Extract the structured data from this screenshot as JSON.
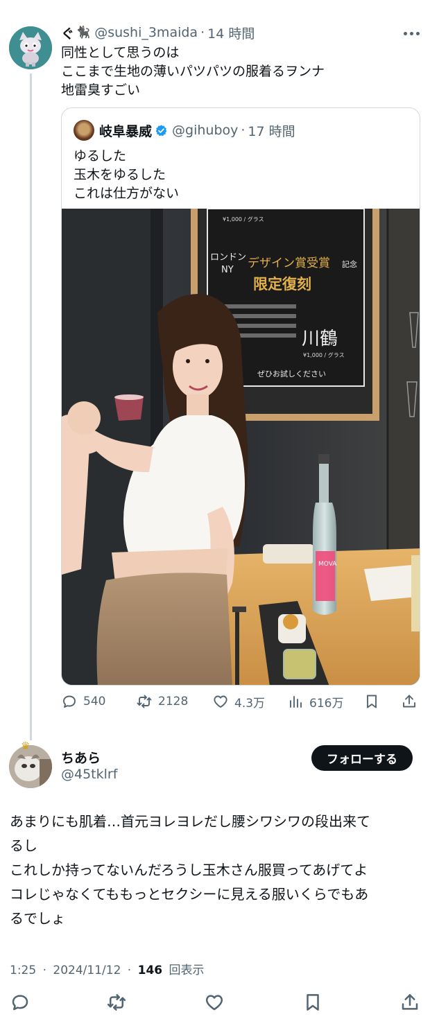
{
  "thread": {
    "parent": {
      "display_name": "ぐ",
      "name_emoji": "🐈‍⬛",
      "handle": "@sushi_3maida",
      "separator": "·",
      "time": "14 時間",
      "text": "同性として思うのは\nここまで生地の薄いパツパツの服着るヲンナ\n地雷臭すごい",
      "avatar_icon": "cartoon-cat-avatar",
      "quote": {
        "display_name": "岐阜暴威",
        "verified_icon": "verified-badge-icon",
        "handle": "@gihuboy",
        "separator": "·",
        "time": "17 時間",
        "text": "ゆるした\n玉木をゆるした\nこれは仕方がない",
        "photo": {
          "menu_price_top": "¥1,000 / グラス",
          "menu_left": "ロンドン\nNY",
          "menu_award": "デザイン賞受賞",
          "menu_award_suffix": "記念",
          "menu_limited": "限定復刻",
          "menu_brand": "川鶴",
          "menu_price_bottom": "¥1,000 / グラス",
          "menu_footer": "ぜひお試しください",
          "bottle_label": "MOVA"
        }
      },
      "actions": {
        "replies": "540",
        "reposts": "2128",
        "likes": "4.3万",
        "views": "616万"
      }
    },
    "reply": {
      "display_name": "ちあら",
      "handle": "@45tklrf",
      "follow_label": "フォローする",
      "text": "あまりにも肌着…首元ヨレヨレだし腰シワシワの段出来て\nるし\nこれしか持ってないんだろうし玉木さん服買ってあげてよ\nコレじゃなくてももっとセクシーに見える服いくらでもあ\nるでしょ",
      "time": "1:25",
      "date": "2024/11/12",
      "separator": "·",
      "view_count": "146",
      "view_label": "回表示"
    }
  },
  "colors": {
    "text_primary": "#0f1419",
    "text_secondary": "#536471",
    "border": "#cfd9de",
    "verified_blue": "#1d9bf0",
    "follow_bg": "#0f1419"
  }
}
